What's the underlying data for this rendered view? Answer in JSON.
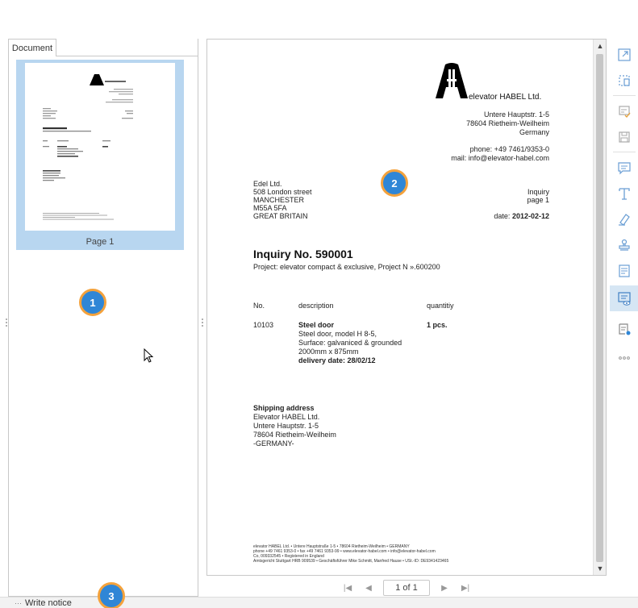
{
  "left_panel": {
    "tab_label": "Document",
    "thumbnail_label": "Page 1"
  },
  "document": {
    "logo_text": "elevator HABEL Ltd.",
    "sender": {
      "street": "Untere Hauptstr. 1-5",
      "city": "78604 Rietheim-Weilheim",
      "country": "Germany",
      "phone": "phone: +49 7461/9353-0",
      "mail": "mail: info@elevator-habel.com"
    },
    "recipient": {
      "name": "Edel Ltd.",
      "street": "508 London street",
      "city": "MANCHESTER",
      "postcode": "M55A 5FA",
      "country": "GREAT BRITAIN"
    },
    "doc_type": "Inquiry",
    "page": "page 1",
    "date_label": "date:",
    "date_value": "2012-02-12",
    "title": "Inquiry No. 590001",
    "project": "Project: elevator compact & exclusive, Project N ».600200",
    "table": {
      "headers": [
        "No.",
        "description",
        "quantitiy"
      ],
      "row": {
        "no": "10103",
        "item": "Steel door",
        "lines": [
          "Steel door, model H 8-5,",
          "Surface: galvaniced & grounded",
          "2000mm x 875mm"
        ],
        "delivery": "delivery date: 28/02/12",
        "quantity": "1 pcs."
      }
    },
    "shipping": {
      "heading": "Shipping address",
      "lines": [
        "Elevator HABEL Ltd.",
        "Untere Hauptstr. 1-5",
        "78604 Rietheim-Weilheim",
        "-GERMANY-"
      ]
    },
    "footer_lines": [
      "elevator HABEL Ltd. • Untere Hauptstraße 1-5 • 78604 Rietheim-Weilheim • GERMANY",
      "phone +49 7461 9353-0 • fax +49 7461 9353-99 • www.elevator-habel.com • info@elevator-habel.com",
      "Co, 009332545 • Registered in England",
      "Amtsgericht Stuttgart HRB 909539 • Geschäftsführer Mike Schmitt, Manfred Hause • USt.-ID: DE9341423465"
    ]
  },
  "page_nav": {
    "current": "1 of 1"
  },
  "toolbar": {
    "tools": [
      "export-icon",
      "crop-icon",
      "sign-check-icon",
      "save-icon",
      "comment-icon",
      "text-icon",
      "highlighter-icon",
      "stamp-icon",
      "form-icon",
      "review-icon",
      "attach-note-icon",
      "more-icon"
    ]
  },
  "status": {
    "label": "Write notice"
  },
  "markers": {
    "m1": "1",
    "m2": "2",
    "m3": "3"
  },
  "colors": {
    "selection": "#b8d6f0",
    "marker_fill": "#2f86d6",
    "marker_ring": "#f4a23c",
    "toolbar_active": "#d6e6f4"
  }
}
